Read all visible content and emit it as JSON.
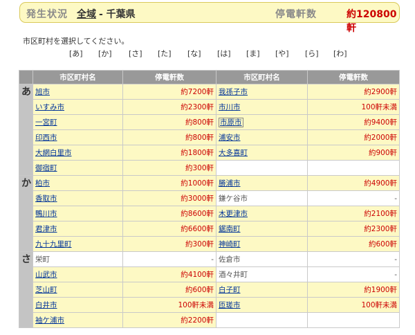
{
  "header": {
    "status_label": "発生状況",
    "region_link": "全域",
    "prefecture": "- 千葉県",
    "outage_label": "停電軒数",
    "outage_total": "約120800軒"
  },
  "instruction": "市区町村を選択してください。",
  "kana_nav": [
    "[あ]",
    "[か]",
    "[さ]",
    "[た]",
    "[な]",
    "[は]",
    "[ま]",
    "[や]",
    "[ら]",
    "[わ]"
  ],
  "table": {
    "headers": [
      "市区町村名",
      "停電軒数",
      "市区町村名",
      "停電軒数"
    ],
    "sections": [
      {
        "kana": "あ",
        "rows": [
          {
            "l_name": "旭市",
            "l_count": "約7200軒",
            "r_name": "我孫子市",
            "r_count": "約2900軒"
          },
          {
            "l_name": "いすみ市",
            "l_count": "約2300軒",
            "r_name": "市川市",
            "r_count": "100軒未満"
          },
          {
            "l_name": "一宮町",
            "l_count": "約800軒",
            "r_name": "市原市",
            "r_count": "約9400軒"
          },
          {
            "l_name": "印西市",
            "l_count": "約800軒",
            "r_name": "浦安市",
            "r_count": "約2000軒"
          },
          {
            "l_name": "大網白里市",
            "l_count": "約1800軒",
            "r_name": "大多喜町",
            "r_count": "約900軒"
          },
          {
            "l_name": "御宿町",
            "l_count": "約300軒",
            "r_name": "",
            "r_count": ""
          }
        ]
      },
      {
        "kana": "か",
        "rows": [
          {
            "l_name": "柏市",
            "l_count": "約1000軒",
            "r_name": "勝浦市",
            "r_count": "約4900軒"
          },
          {
            "l_name": "香取市",
            "l_count": "約3000軒",
            "r_name": "鎌ケ谷市",
            "r_count": "-"
          },
          {
            "l_name": "鴨川市",
            "l_count": "約8600軒",
            "r_name": "木更津市",
            "r_count": "約2100軒"
          },
          {
            "l_name": "君津市",
            "l_count": "約6600軒",
            "r_name": "鋸南町",
            "r_count": "約2300軒"
          },
          {
            "l_name": "九十九里町",
            "l_count": "約300軒",
            "r_name": "神崎町",
            "r_count": "約600軒"
          }
        ]
      },
      {
        "kana": "さ",
        "rows": [
          {
            "l_name": "栄町",
            "l_count": "-",
            "r_name": "佐倉市",
            "r_count": "-"
          },
          {
            "l_name": "山武市",
            "l_count": "約4100軒",
            "r_name": "酒々井町",
            "r_count": "-"
          },
          {
            "l_name": "芝山町",
            "l_count": "約600軒",
            "r_name": "白子町",
            "r_count": "約1900軒"
          },
          {
            "l_name": "白井市",
            "l_count": "100軒未満",
            "r_name": "匝瑳市",
            "r_count": "100軒未満"
          },
          {
            "l_name": "袖ケ浦市",
            "l_count": "約2200軒",
            "r_name": "",
            "r_count": ""
          }
        ]
      }
    ]
  }
}
